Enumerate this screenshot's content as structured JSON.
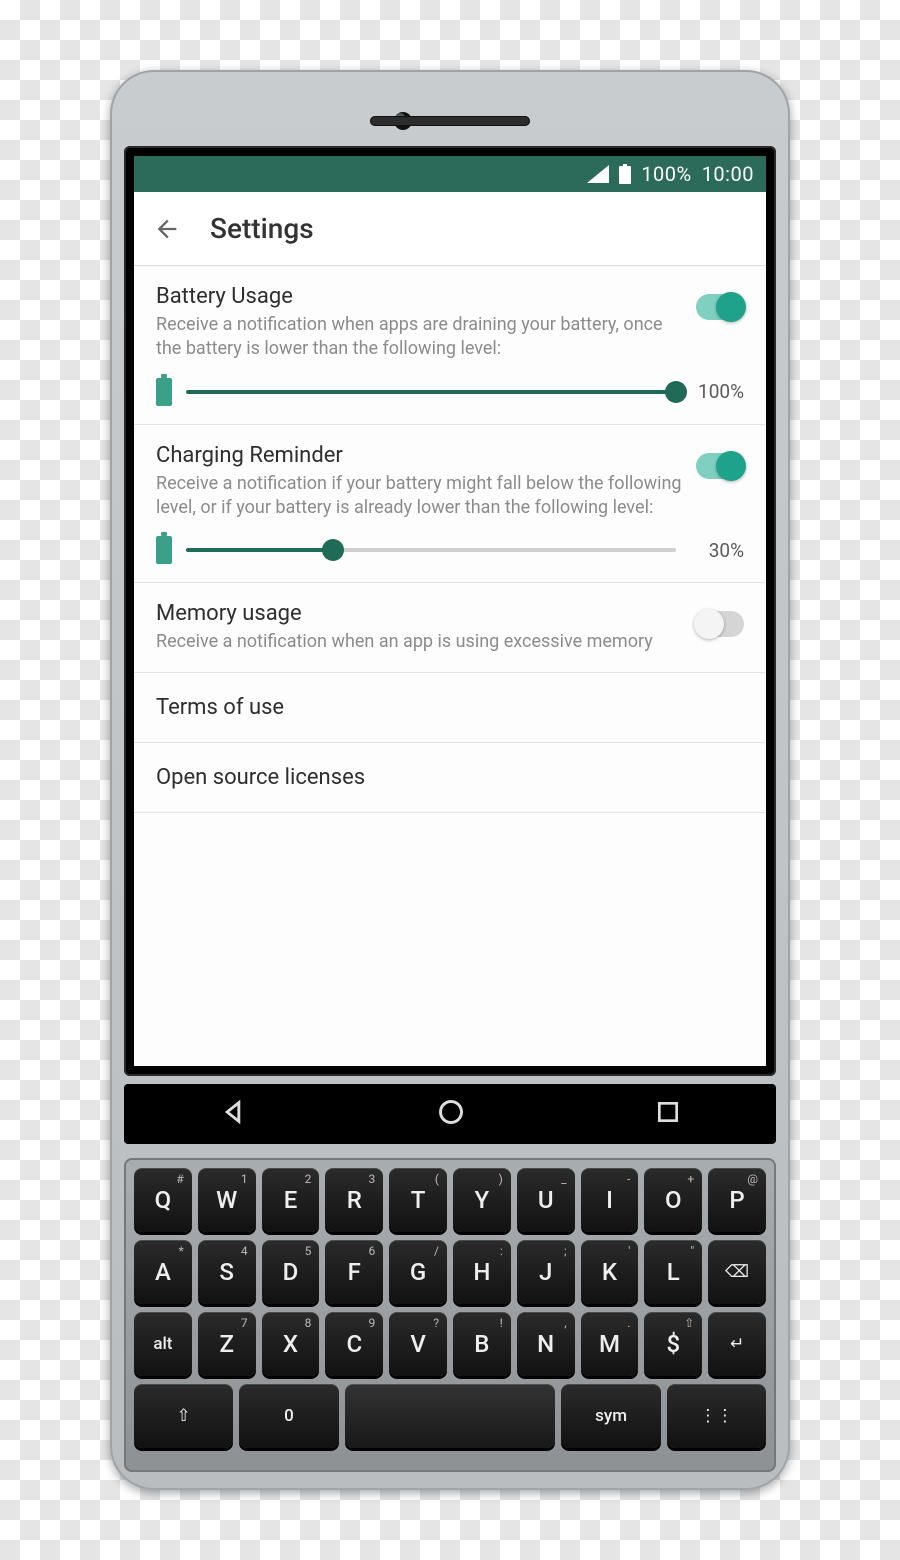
{
  "status": {
    "battery": "100%",
    "time": "10:00"
  },
  "appbar": {
    "title": "Settings"
  },
  "settings": {
    "battery": {
      "title": "Battery Usage",
      "desc": "Receive a notification when apps are draining your battery, once the battery is lower than the following level:",
      "enabled": true,
      "slider": {
        "percent": 100,
        "label": "100%"
      }
    },
    "charging": {
      "title": "Charging Reminder",
      "desc": "Receive a notification if your battery might fall below the following level, or if your battery is already lower than the following level:",
      "enabled": true,
      "slider": {
        "percent": 30,
        "label": "30%"
      }
    },
    "memory": {
      "title": "Memory usage",
      "desc": "Receive a notification when an app is using excessive memory",
      "enabled": false
    },
    "terms": {
      "title": "Terms of use"
    },
    "licenses": {
      "title": "Open source licenses"
    }
  },
  "keyboard": {
    "row1": [
      {
        "k": "Q",
        "s": "#"
      },
      {
        "k": "W",
        "s": "1"
      },
      {
        "k": "E",
        "s": "2"
      },
      {
        "k": "R",
        "s": "3"
      },
      {
        "k": "T",
        "s": "("
      },
      {
        "k": "Y",
        "s": ")"
      },
      {
        "k": "U",
        "s": "_"
      },
      {
        "k": "I",
        "s": "-"
      },
      {
        "k": "O",
        "s": "+"
      },
      {
        "k": "P",
        "s": "@"
      }
    ],
    "row2": [
      {
        "k": "A",
        "s": "*"
      },
      {
        "k": "S",
        "s": "4"
      },
      {
        "k": "D",
        "s": "5"
      },
      {
        "k": "F",
        "s": "6"
      },
      {
        "k": "G",
        "s": "/"
      },
      {
        "k": "H",
        "s": ":"
      },
      {
        "k": "J",
        "s": ";"
      },
      {
        "k": "K",
        "s": "'"
      },
      {
        "k": "L",
        "s": "\""
      },
      {
        "k": "⌫",
        "s": ""
      }
    ],
    "row3": [
      {
        "k": "alt",
        "s": ""
      },
      {
        "k": "Z",
        "s": "7"
      },
      {
        "k": "X",
        "s": "8"
      },
      {
        "k": "C",
        "s": "9"
      },
      {
        "k": "V",
        "s": "?"
      },
      {
        "k": "B",
        "s": "!"
      },
      {
        "k": "N",
        "s": ","
      },
      {
        "k": "M",
        "s": "."
      },
      {
        "k": "$",
        "s": "⇧"
      },
      {
        "k": "↵",
        "s": ""
      }
    ],
    "row4": [
      {
        "k": "⇧"
      },
      {
        "k": "0"
      },
      {
        "k": "space"
      },
      {
        "k": "sym"
      },
      {
        "k": "⋮⋮⋮"
      }
    ]
  }
}
